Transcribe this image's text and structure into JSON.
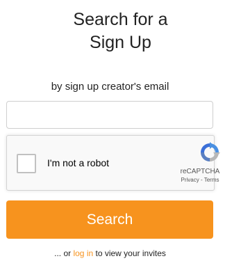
{
  "page": {
    "title_line1": "Search for a",
    "title_line2": "Sign Up",
    "subtitle": "by sign up creator's email"
  },
  "email_input": {
    "value": "",
    "placeholder": ""
  },
  "recaptcha": {
    "checkbox_label": "I'm not a robot",
    "brand": "reCAPTCHA",
    "privacy_link": "Privacy",
    "separator": " - ",
    "terms_link": "Terms",
    "logo_icon": "recaptcha-logo-icon"
  },
  "search_button": {
    "label": "Search"
  },
  "footer": {
    "prefix": "... or ",
    "login_link": "log in",
    "suffix": " to view your invites"
  },
  "colors": {
    "accent": "#f7931e",
    "button_text": "#ffffff",
    "text": "#222222",
    "recaptcha_blue": "#4a90e2",
    "recaptcha_gray": "#b7b7b7"
  }
}
